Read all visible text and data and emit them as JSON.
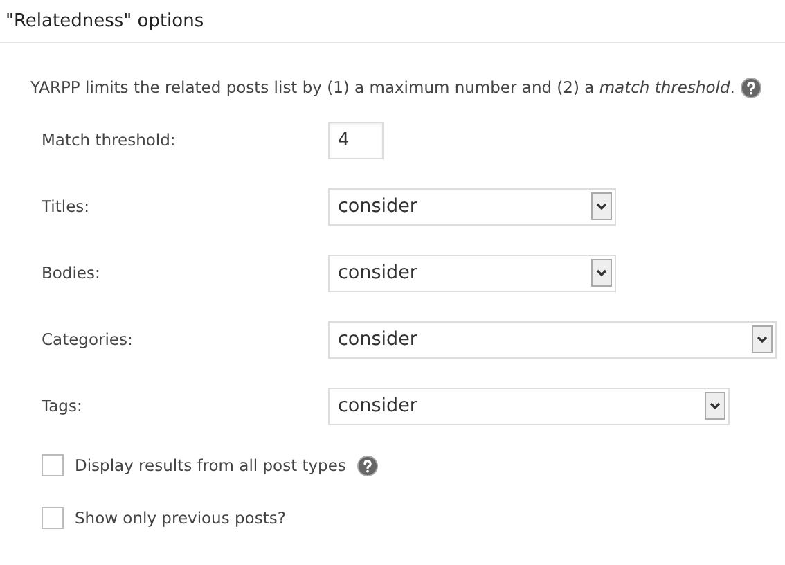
{
  "header": {
    "title": "\"Relatedness\" options"
  },
  "intro": {
    "text": "YARPP limits the related posts list by (1) a maximum number and (2) a *match threshold*.",
    "help": true
  },
  "threshold": {
    "label": "Match threshold:",
    "value": "4"
  },
  "fields": [
    {
      "label": "Titles:",
      "value": "consider"
    },
    {
      "label": "Bodies:",
      "value": "consider"
    },
    {
      "label": "Categories:",
      "value": "consider"
    },
    {
      "label": "Tags:",
      "value": "consider"
    }
  ],
  "options": [
    {
      "label": "Display results from all post types",
      "checked": false,
      "help": true
    },
    {
      "label": "Show only previous posts?",
      "checked": false,
      "help": false
    }
  ]
}
